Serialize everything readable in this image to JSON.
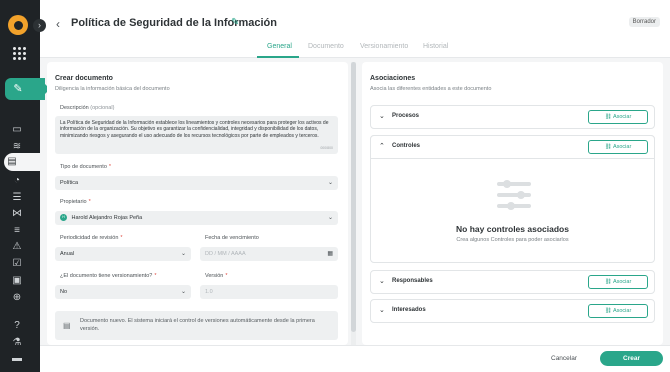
{
  "header": {
    "title": "Política de Seguridad de la Información",
    "status_badge": "Borrador",
    "tabs": [
      "General",
      "Documento",
      "Versionamiento",
      "Historial"
    ],
    "active_tab": "General"
  },
  "left": {
    "section_title": "Crear documento",
    "section_subtitle": "Diligencia la información básica del documento",
    "description_label": "Descripción",
    "description_optional": "(opcional)",
    "description_value": "La Política de Seguridad de la Información establece los lineamientos y controles necesarios para proteger los activos de información de la organización. Su objetivo es garantizar la confidencialidad, integridad y disponibilidad de los datos, minimizando riesgos y asegurando el uso adecuado de los recursos tecnológicos por parte de empleados y terceros.",
    "description_counter": "000/800",
    "doc_type_label": "Tipo de documento",
    "doc_type_value": "Política",
    "owner_label": "Propietario",
    "owner_initials": "H",
    "owner_value": "Harold Alejandro Rojas Peña",
    "review_label": "Periodicidad de revisión",
    "review_value": "Anual",
    "expiry_label": "Fecha de vencimiento",
    "expiry_placeholder": "DD / MM / AAAA",
    "versioned_label": "¿El documento tiene versionamiento?",
    "versioned_value": "No",
    "version_label": "Versión",
    "version_placeholder": "1.0",
    "info_text": "Documento nuevo. El sistema iniciará el control de versiones automáticamente desde la primera versión."
  },
  "right": {
    "section_title": "Asociaciones",
    "section_subtitle": "Asocia las diferentes entidades a este documento",
    "associate_label": "Asociar",
    "rows": [
      "Procesos",
      "Controles",
      "Responsables",
      "Interesados"
    ],
    "empty_title": "No hay controles asociados",
    "empty_subtitle": "Crea algunos Controles para poder asociarlos"
  },
  "footer": {
    "cancel_label": "Cancelar",
    "create_label": "Crear"
  },
  "colors": {
    "accent": "#2aa68a",
    "sidebar": "#1f2326",
    "logo": "#f2a22b",
    "required": "#e0483e"
  },
  "icons": {
    "sidebar": [
      "logo-icon",
      "apps-grid-icon",
      "document-sign-icon",
      "monitor-icon",
      "layers-icon",
      "document-icon",
      "shield-check-icon",
      "list-icon",
      "network-icon",
      "sliders-icon",
      "alert-icon",
      "checklist-icon",
      "bag-icon",
      "target-icon",
      "help-icon",
      "flask-icon",
      "card-icon"
    ]
  }
}
